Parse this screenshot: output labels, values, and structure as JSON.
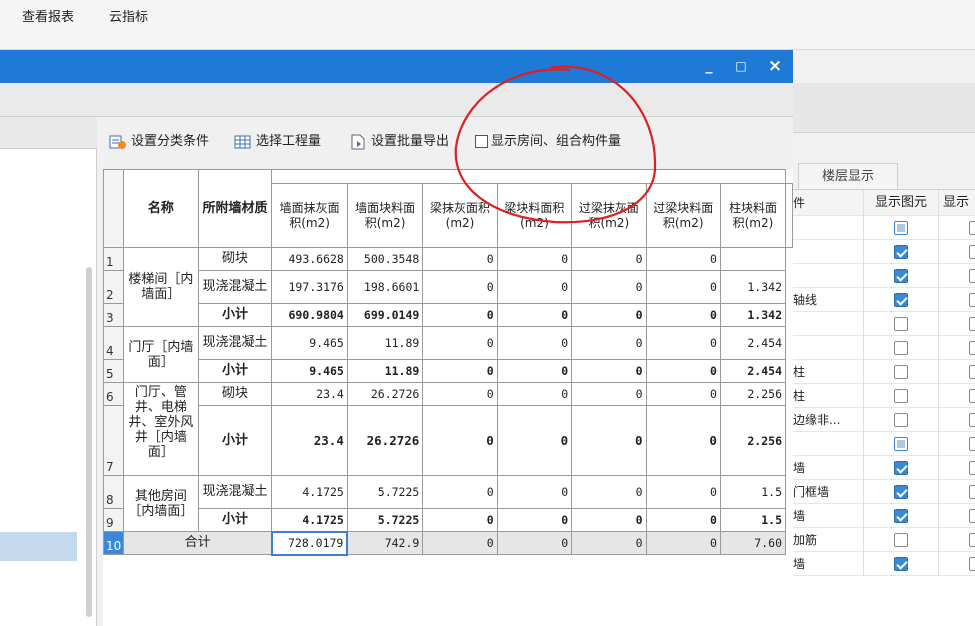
{
  "topbar": {
    "btn1": "查看报表",
    "btn2": "云指标"
  },
  "dialog": {
    "controls": {
      "minimize": "_",
      "maximize": "□",
      "close": "×"
    },
    "toolbar": {
      "classify": "设置分类条件",
      "select_qty": "选择工程量",
      "batch_export": "设置批量导出",
      "show_rooms": "显示房间、组合构件量",
      "show_rooms_checked": false
    }
  },
  "table": {
    "headers": [
      "名称",
      "所附墙材质",
      "墙面抹灰面积(m2)",
      "墙面块料面积(m2)",
      "梁抹灰面积(m2)",
      "梁块料面积(m2)",
      "过梁抹灰面积(m2)",
      "过梁块料面积(m2)",
      "柱块料面积(m2)"
    ],
    "rows": [
      {
        "idx": "1",
        "material": "砌块",
        "vals": [
          "493.6628",
          "500.3548",
          "0",
          "0",
          "0",
          "0",
          ""
        ]
      },
      {
        "idx": "2",
        "material": "现浇混凝土",
        "vals": [
          "197.3176",
          "198.6601",
          "0",
          "0",
          "0",
          "0",
          "1.342"
        ]
      },
      {
        "idx": "3",
        "material": "小计",
        "vals": [
          "690.9804",
          "699.0149",
          "0",
          "0",
          "0",
          "0",
          "1.342"
        ]
      },
      {
        "idx": "4",
        "material": "现浇混凝土",
        "vals": [
          "9.465",
          "11.89",
          "0",
          "0",
          "0",
          "0",
          "2.454"
        ]
      },
      {
        "idx": "5",
        "material": "小计",
        "vals": [
          "9.465",
          "11.89",
          "0",
          "0",
          "0",
          "0",
          "2.454"
        ]
      },
      {
        "idx": "6",
        "material": "砌块",
        "vals": [
          "23.4",
          "26.2726",
          "0",
          "0",
          "0",
          "0",
          "2.256"
        ]
      },
      {
        "idx": "7",
        "material": "小计",
        "vals": [
          "23.4",
          "26.2726",
          "0",
          "0",
          "0",
          "0",
          "2.256"
        ]
      },
      {
        "idx": "8",
        "material": "现浇混凝土",
        "vals": [
          "4.1725",
          "5.7225",
          "0",
          "0",
          "0",
          "0",
          "1.5"
        ]
      },
      {
        "idx": "9",
        "material": "小计",
        "vals": [
          "4.1725",
          "5.7225",
          "0",
          "0",
          "0",
          "0",
          "1.5"
        ]
      },
      {
        "idx": "10",
        "material": "合计",
        "vals": [
          "728.0179",
          "742.9",
          "0",
          "0",
          "0",
          "0",
          "7.60"
        ]
      }
    ],
    "groups": [
      "楼梯间［内墙面］",
      "门厅［内墙面］",
      "门厅、管井、电梯井、室外风井［内墙面］",
      "其他房间［内墙面］"
    ]
  },
  "right_panel": {
    "tab": "楼层显示",
    "col_name": "件",
    "col_show": "显示图元",
    "col_show2": "显示",
    "rows": [
      {
        "name": "",
        "c1": "partial"
      },
      {
        "name": "",
        "c1": "on"
      },
      {
        "name": "",
        "c1": "on"
      },
      {
        "name": "轴线",
        "c1": "on"
      },
      {
        "name": "",
        "c1": "off"
      },
      {
        "name": "",
        "c1": "off"
      },
      {
        "name": "柱",
        "c1": "off"
      },
      {
        "name": "柱",
        "c1": "off"
      },
      {
        "name": "边缘非...",
        "c1": "off"
      },
      {
        "name": "",
        "c1": "partial"
      },
      {
        "name": "墙",
        "c1": "on"
      },
      {
        "name": "门框墙",
        "c1": "on"
      },
      {
        "name": "墙",
        "c1": "on"
      },
      {
        "name": "加筋",
        "c1": "off"
      },
      {
        "name": "墙",
        "c1": "on"
      }
    ]
  },
  "colors": {
    "title_bar": "#1e7ad6",
    "checkbox_on": "#3b88d4",
    "annotation": "#e02020"
  }
}
